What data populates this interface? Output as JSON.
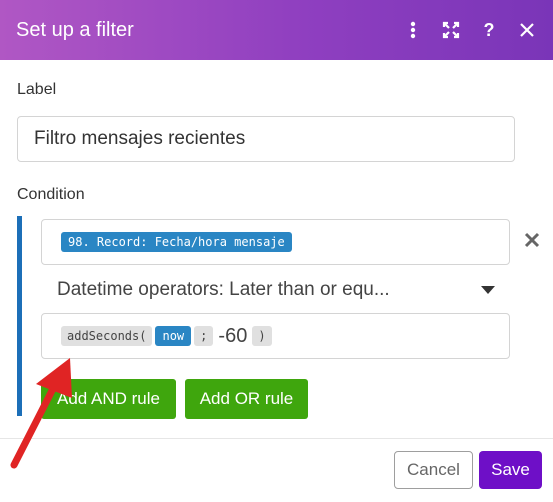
{
  "dialog": {
    "title": "Set up a filter",
    "accent_gradient": [
      "#b057c4",
      "#7a35b8"
    ]
  },
  "header_tools": [
    {
      "icon": "more-vertical-icon"
    },
    {
      "icon": "expand-icon"
    },
    {
      "icon": "help-icon",
      "glyph": "?"
    },
    {
      "icon": "close-icon"
    }
  ],
  "label_section": {
    "label": "Label",
    "value": "Filtro mensajes recientes"
  },
  "condition_section": {
    "label": "Condition",
    "bar_color": "#1c6fb8",
    "operand1": {
      "pill": "98. Record: Fecha/hora mensaje",
      "pill_color": "#2a86c4"
    },
    "operator": "Datetime operators: Later than or equ...",
    "operand2": {
      "func_open": "addSeconds(",
      "arg_pill": "now",
      "separator": ";",
      "literal": "-60",
      "func_close": ")"
    },
    "remove_icon": "close-x-icon"
  },
  "rule_buttons": {
    "and_label": "Add AND rule",
    "or_label": "Add OR rule",
    "color": "#3fa60d"
  },
  "footer": {
    "cancel_label": "Cancel",
    "save_label": "Save",
    "save_color": "#6e0fc7"
  },
  "annotation": {
    "arrow_color": "#e02424",
    "icon": "red-arrow-icon"
  }
}
